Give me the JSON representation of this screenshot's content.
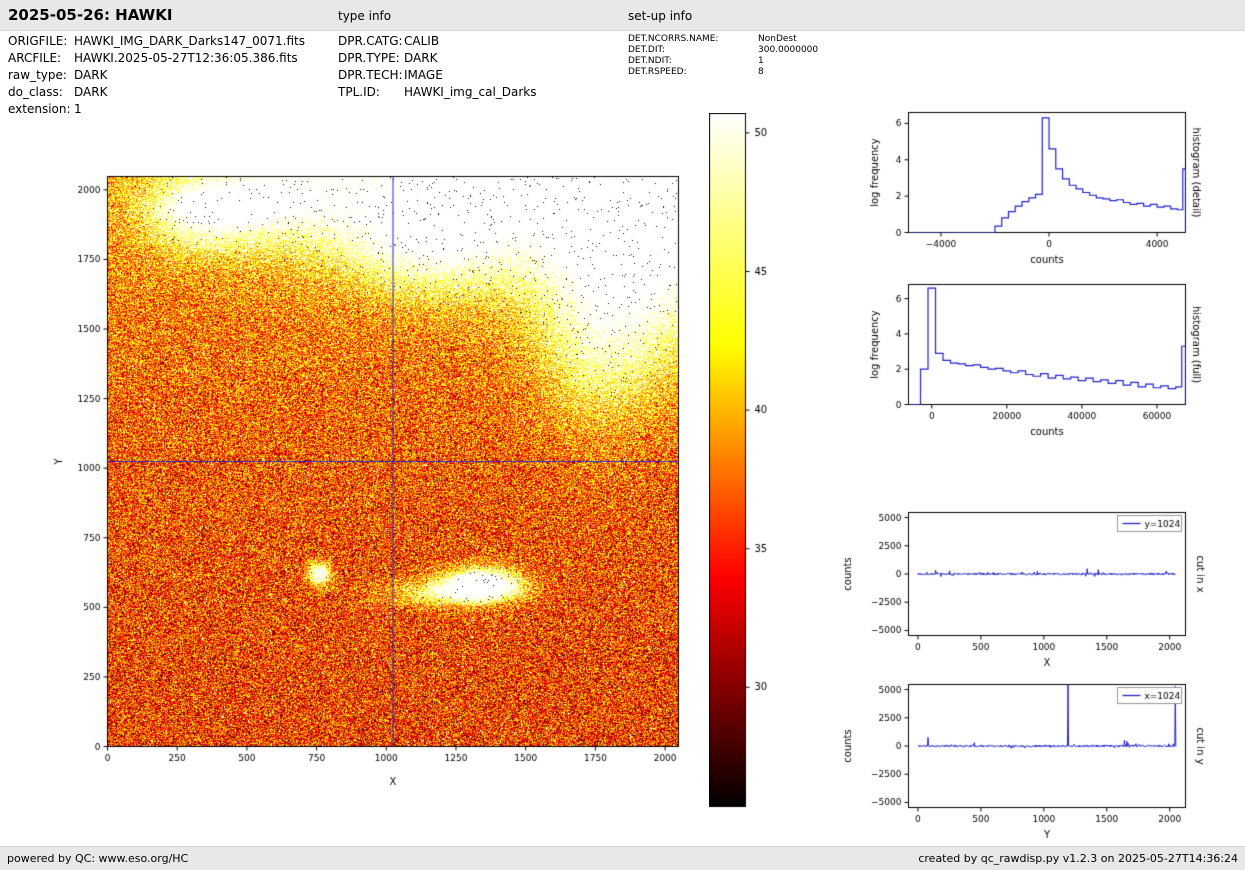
{
  "header": {
    "title": "2025-05-26: HAWKI",
    "type_info": "type info",
    "setup_info": "set-up info"
  },
  "meta": {
    "left": [
      {
        "label": "ORIGFILE:",
        "value": "HAWKI_IMG_DARK_Darks147_0071.fits"
      },
      {
        "label": "ARCFILE:",
        "value": "HAWKI.2025-05-27T12:36:05.386.fits"
      },
      {
        "label": "raw_type:",
        "value": "DARK"
      },
      {
        "label": "do_class:",
        "value": "DARK"
      },
      {
        "label": "extension:",
        "value": "1"
      }
    ],
    "middle": [
      {
        "label": "DPR.CATG:",
        "value": "CALIB"
      },
      {
        "label": "DPR.TYPE:",
        "value": "DARK"
      },
      {
        "label": "DPR.TECH:",
        "value": "IMAGE"
      },
      {
        "label": "TPL.ID:",
        "value": "HAWKI_img_cal_Darks"
      }
    ],
    "right": [
      {
        "label": "DET.NCORRS.NAME:",
        "value": "NonDest"
      },
      {
        "label": "DET.DIT:",
        "value": "300.0000000"
      },
      {
        "label": "DET.NDIT:",
        "value": "1"
      },
      {
        "label": "DET.RSPEED:",
        "value": "8"
      }
    ]
  },
  "footer": {
    "left": "powered by QC: www.eso.org/HC",
    "right": "created by qc_rawdisp.py v1.2.3 on 2025-05-27T14:36:24"
  },
  "colors": {
    "accent_line": "#2323cc",
    "crosshair": "#2828c8",
    "header_bg": "#e8e8e8"
  },
  "chart_data": [
    {
      "id": "main_image",
      "type": "heatmap",
      "xlabel": "X",
      "ylabel": "Y",
      "xlim": [
        0,
        2048
      ],
      "ylim": [
        0,
        2048
      ],
      "xticks": [
        0,
        250,
        500,
        750,
        1000,
        1250,
        1500,
        1750,
        2000
      ],
      "yticks": [
        0,
        250,
        500,
        750,
        1000,
        1250,
        1500,
        1750,
        2000
      ],
      "colormap": "hot",
      "crosshair": {
        "x": 1024,
        "y": 1024
      },
      "colorbar": {
        "vmin": 25.7,
        "vmax": 50.7,
        "ticks": [
          30,
          35,
          40,
          45,
          50
        ]
      },
      "noise_seed": 1234,
      "bright_regions": [
        [
          1450,
          1990,
          420,
          230,
          0.6
        ],
        [
          650,
          1990,
          260,
          140,
          0.5
        ],
        [
          1940,
          1760,
          230,
          280,
          0.55
        ],
        [
          1150,
          1830,
          190,
          130,
          0.4
        ],
        [
          330,
          1900,
          140,
          90,
          0.35
        ],
        [
          430,
          1945,
          130,
          45,
          0.5
        ],
        [
          1750,
          1450,
          150,
          220,
          0.3
        ],
        [
          1980,
          1990,
          200,
          170,
          0.5
        ],
        [
          1340,
          585,
          95,
          38,
          0.95
        ],
        [
          1235,
          550,
          150,
          32,
          0.45
        ],
        [
          760,
          620,
          28,
          28,
          0.75
        ]
      ],
      "description": "Raw dark frame detector image, mostly red/orange noise, saturated white regions toward the top and a bright streak near (1340,585)"
    },
    {
      "id": "hist_detail",
      "type": "step",
      "side_label": "histogram (detail)",
      "xlabel": "counts",
      "ylabel": "log frequency",
      "xlim": [
        -5200,
        5050
      ],
      "ylim": [
        0,
        6.6
      ],
      "xticks": [
        -4000,
        0,
        4000
      ],
      "yticks": [
        0,
        2,
        4,
        6
      ],
      "bin_edges": [
        -2000,
        -1750,
        -1500,
        -1250,
        -1000,
        -750,
        -500,
        -250,
        0,
        250,
        500,
        750,
        1000,
        1250,
        1500,
        1750,
        2000,
        2250,
        2500,
        2750,
        3000,
        3250,
        3500,
        3750,
        4000,
        4250,
        4500,
        4750,
        4950,
        5050
      ],
      "heights": [
        0.35,
        0.8,
        1.15,
        1.45,
        1.7,
        1.9,
        2.1,
        6.3,
        4.6,
        3.5,
        2.95,
        2.6,
        2.4,
        2.2,
        2.05,
        1.9,
        1.85,
        1.75,
        1.8,
        1.65,
        1.55,
        1.6,
        1.45,
        1.55,
        1.4,
        1.45,
        1.3,
        1.25,
        3.5
      ]
    },
    {
      "id": "hist_full",
      "type": "step",
      "side_label": "histogram (full)",
      "xlabel": "counts",
      "ylabel": "log frequency",
      "xlim": [
        -6200,
        67600
      ],
      "ylim": [
        0,
        6.8
      ],
      "xticks": [
        0,
        20000,
        40000,
        60000
      ],
      "yticks": [
        0,
        2,
        4,
        6
      ],
      "bin_edges": [
        -3000,
        -1000,
        1000,
        3000,
        5000,
        7000,
        9000,
        11000,
        13000,
        15000,
        17000,
        19000,
        21000,
        23000,
        25000,
        27000,
        29000,
        31000,
        33000,
        35000,
        37000,
        39000,
        41000,
        43000,
        45000,
        47000,
        49000,
        51000,
        53000,
        55000,
        57000,
        59000,
        61000,
        63000,
        65000,
        66600,
        67600
      ],
      "heights": [
        2.0,
        6.6,
        2.9,
        2.5,
        2.35,
        2.3,
        2.2,
        2.25,
        2.1,
        2.0,
        2.05,
        1.9,
        1.8,
        1.9,
        1.7,
        1.6,
        1.75,
        1.5,
        1.65,
        1.45,
        1.55,
        1.35,
        1.5,
        1.3,
        1.4,
        1.2,
        1.35,
        1.1,
        1.25,
        1.0,
        1.15,
        0.95,
        1.05,
        0.9,
        1.0,
        3.3
      ]
    },
    {
      "id": "cut_x",
      "type": "line",
      "legend": "y=1024",
      "side_label": "cut in x",
      "xlabel": "X",
      "ylabel": "counts",
      "xlim": [
        -75,
        2125
      ],
      "ylim": [
        -5450,
        5450
      ],
      "xticks": [
        0,
        500,
        1000,
        1500,
        2000
      ],
      "yticks": [
        -5000,
        -2500,
        0,
        2500,
        5000
      ],
      "noise_amplitude": 90,
      "seed": 7,
      "spikes": [
        [
          140,
          360
        ],
        [
          252,
          280
        ],
        [
          948,
          240
        ],
        [
          1345,
          470
        ],
        [
          1430,
          390
        ],
        [
          1972,
          260
        ]
      ]
    },
    {
      "id": "cut_y",
      "type": "line",
      "legend": "x=1024",
      "side_label": "cut in y",
      "xlabel": "Y",
      "ylabel": "counts",
      "xlim": [
        -75,
        2125
      ],
      "ylim": [
        -5450,
        5450
      ],
      "xticks": [
        0,
        500,
        1000,
        1500,
        2000
      ],
      "yticks": [
        -5000,
        -2500,
        0,
        2500,
        5000
      ],
      "noise_amplitude": 90,
      "seed": 11,
      "spikes": [
        [
          78,
          760
        ],
        [
          448,
          300
        ],
        [
          1190,
          5600
        ],
        [
          1640,
          520
        ],
        [
          1658,
          420
        ],
        [
          2042,
          5300
        ]
      ]
    }
  ]
}
